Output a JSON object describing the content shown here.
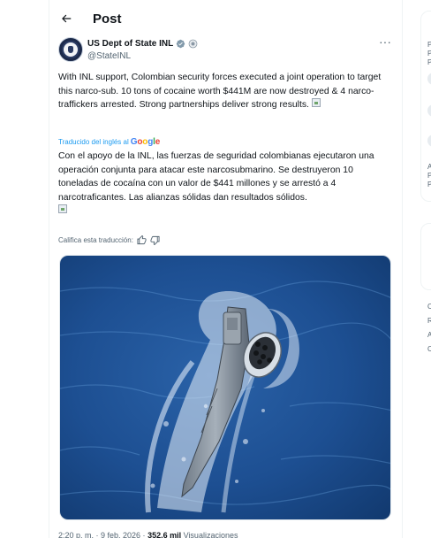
{
  "header": {
    "title": "Post"
  },
  "author": {
    "name": "US Dept of State INL",
    "handle": "@StateINL"
  },
  "tweet": {
    "text": "With INL support, Colombian security forces executed a joint operation to target this narco-sub. 10 tons of cocaine worth $441M are now destroyed & 4 narco-traffickers arrested. Strong partnerships deliver strong results."
  },
  "translation": {
    "label": "Traducido del inglés al",
    "provider": "Google",
    "text": "Con el apoyo de la INL, las fuerzas de seguridad colombianas ejecutaron una operación conjunta para atacar este narcosubmarino. Se destruyeron 10 toneladas de cocaína con un valor de $441 millones y se arrestó a 4 narcotraficantes. Las alianzas sólidas dan resultados sólidos.",
    "rate_label": "Califica esta traducción:"
  },
  "meta": {
    "time": "2:20 p. m. · 9 feb. 2026 · ",
    "views_count": "352,6 mil",
    "views_label": " Visualizaciones"
  },
  "right_sidebar": {
    "snippets": [
      "P",
      "P",
      "P",
      "A",
      "P",
      "P",
      "C",
      "R",
      "A",
      "C"
    ]
  },
  "colors": {
    "accent": "#1d9bf0",
    "text": "#0f1419",
    "muted": "#536471",
    "sea": "#1e4d8f"
  },
  "icons": [
    "back-arrow-icon",
    "verified-badge-icon",
    "affiliate-badge-icon",
    "more-options-icon",
    "broken-image-icon",
    "thumbs-up-icon",
    "thumbs-down-icon"
  ]
}
